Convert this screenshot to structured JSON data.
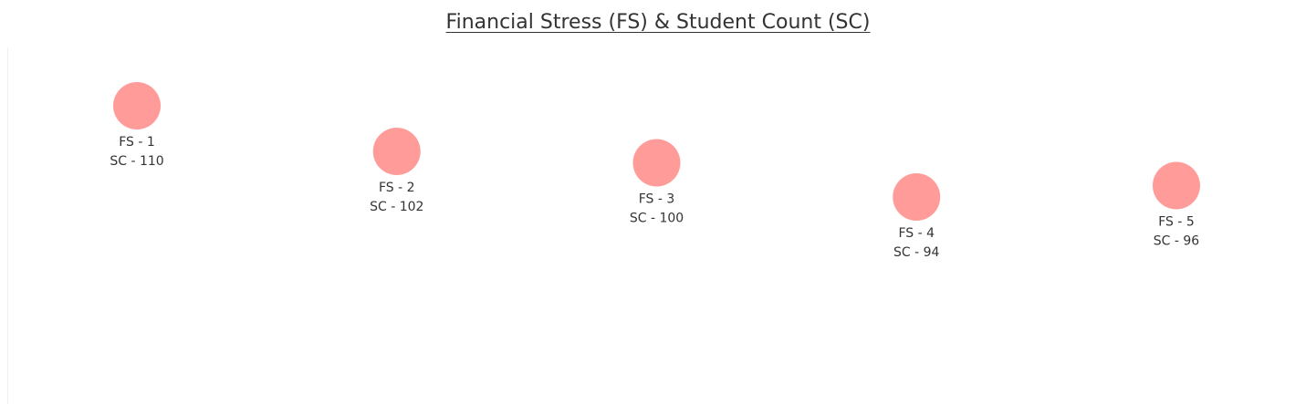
{
  "chart_data": {
    "type": "scatter",
    "title": "Financial Stress (FS) & Student Count (SC)",
    "xlabel": "",
    "ylabel": "",
    "grid": false,
    "legend": "none",
    "color": "#ff9c9a",
    "points": [
      {
        "fs": 1,
        "sc": 110,
        "label_line1": "FS - 1",
        "label_line2": "SC - 110"
      },
      {
        "fs": 2,
        "sc": 102,
        "label_line1": "FS - 2",
        "label_line2": "SC - 102"
      },
      {
        "fs": 3,
        "sc": 100,
        "label_line1": "FS - 3",
        "label_line2": "SC - 100"
      },
      {
        "fs": 4,
        "sc": 94,
        "label_line1": "FS - 4",
        "label_line2": "SC - 94"
      },
      {
        "fs": 5,
        "sc": 96,
        "label_line1": "FS - 5",
        "label_line2": "SC - 96"
      }
    ]
  }
}
